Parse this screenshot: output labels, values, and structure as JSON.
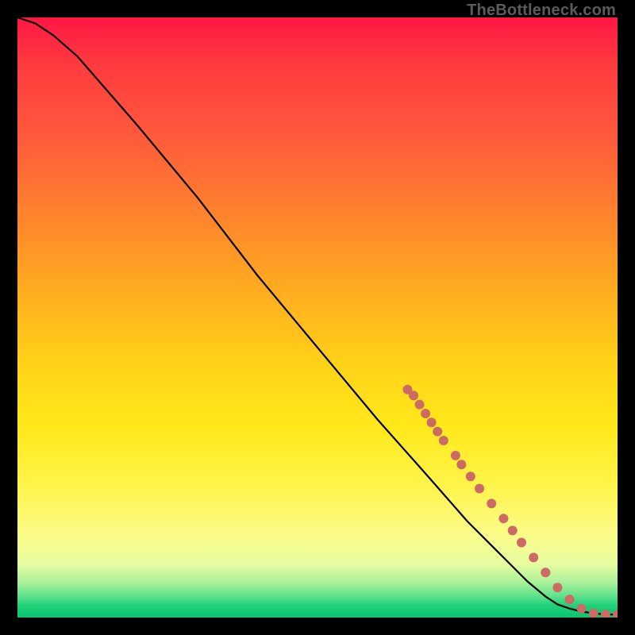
{
  "watermark": "TheBottleneck.com",
  "chart_data": {
    "type": "line",
    "title": "",
    "xlabel": "",
    "ylabel": "",
    "xlim": [
      0,
      100
    ],
    "ylim": [
      0,
      100
    ],
    "grid": false,
    "series": [
      {
        "name": "curve",
        "style": "line",
        "color": "#000000",
        "x": [
          0,
          3,
          6,
          10,
          20,
          30,
          40,
          50,
          60,
          68,
          75,
          80,
          85,
          88,
          90,
          92,
          94,
          96,
          98,
          100
        ],
        "y": [
          100,
          99,
          97,
          93.5,
          82,
          70,
          57,
          45,
          33,
          24,
          16,
          11,
          6,
          3.5,
          2.2,
          1.5,
          1.0,
          0.7,
          0.5,
          0.5
        ]
      },
      {
        "name": "dots",
        "style": "marker",
        "color": "#cc6b63",
        "points": [
          {
            "x": 65,
            "y": 38
          },
          {
            "x": 66,
            "y": 37
          },
          {
            "x": 67,
            "y": 35.5
          },
          {
            "x": 68,
            "y": 34
          },
          {
            "x": 69,
            "y": 32.5
          },
          {
            "x": 70,
            "y": 31
          },
          {
            "x": 71,
            "y": 29.5
          },
          {
            "x": 73,
            "y": 27
          },
          {
            "x": 74,
            "y": 25.5
          },
          {
            "x": 75.5,
            "y": 23.5
          },
          {
            "x": 77,
            "y": 21.5
          },
          {
            "x": 79,
            "y": 19
          },
          {
            "x": 81,
            "y": 16.5
          },
          {
            "x": 82.5,
            "y": 14.5
          },
          {
            "x": 84,
            "y": 12.5
          },
          {
            "x": 86,
            "y": 10
          },
          {
            "x": 88,
            "y": 7.5
          },
          {
            "x": 90,
            "y": 5
          },
          {
            "x": 92,
            "y": 3
          },
          {
            "x": 94,
            "y": 1.5
          },
          {
            "x": 96,
            "y": 0.7
          },
          {
            "x": 98,
            "y": 0.5
          },
          {
            "x": 100,
            "y": 0.5
          }
        ]
      }
    ]
  }
}
